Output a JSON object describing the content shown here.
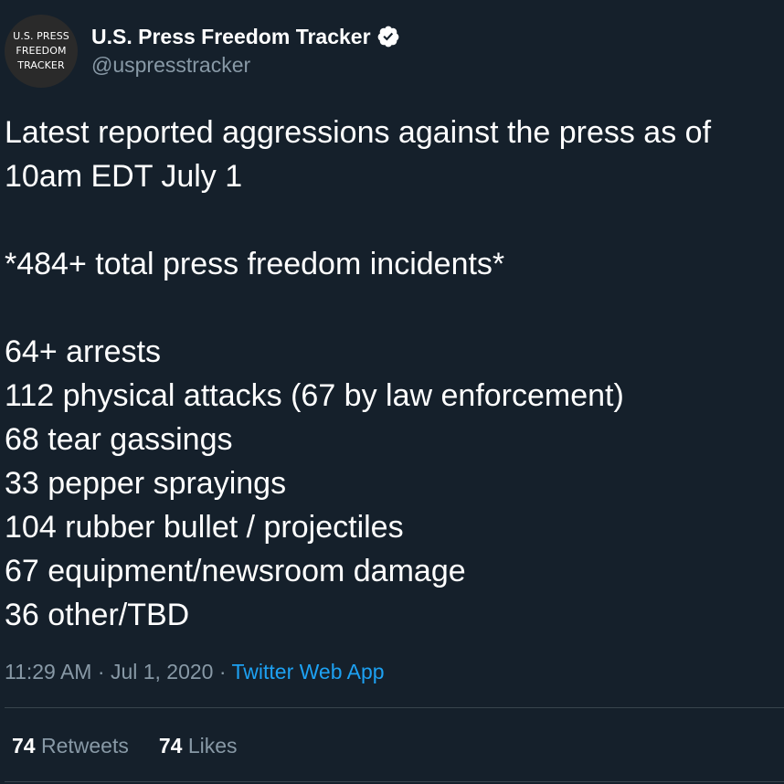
{
  "user": {
    "avatar_lines": [
      "U.S. PRESS",
      "FREEDOM",
      "TRACKER"
    ],
    "display_name": "U.S. Press Freedom Tracker",
    "handle": "@uspresstracker",
    "verified_icon": "verified-badge-icon"
  },
  "tweet": {
    "lines": [
      "Latest reported aggressions against the press as of",
      "10am EDT July 1",
      "",
      "*484+ total press freedom incidents*",
      "",
      "64+ arrests",
      "112 physical attacks (67 by law enforcement)",
      "68 tear gassings",
      "33 pepper sprayings",
      "104 rubber bullet / projectiles",
      "67 equipment/newsroom damage",
      "36 other/TBD"
    ]
  },
  "meta": {
    "time": "11:29 AM",
    "separator1": " · ",
    "date": "Jul 1, 2020",
    "separator2": " · ",
    "source": "Twitter Web App"
  },
  "stats": {
    "retweets_count": "74",
    "retweets_label": "Retweets",
    "likes_count": "74",
    "likes_label": "Likes"
  },
  "colors": {
    "background": "#15202b",
    "text": "#ffffff",
    "muted": "#8899a6",
    "link": "#1da1f2",
    "divider": "#38444d"
  }
}
